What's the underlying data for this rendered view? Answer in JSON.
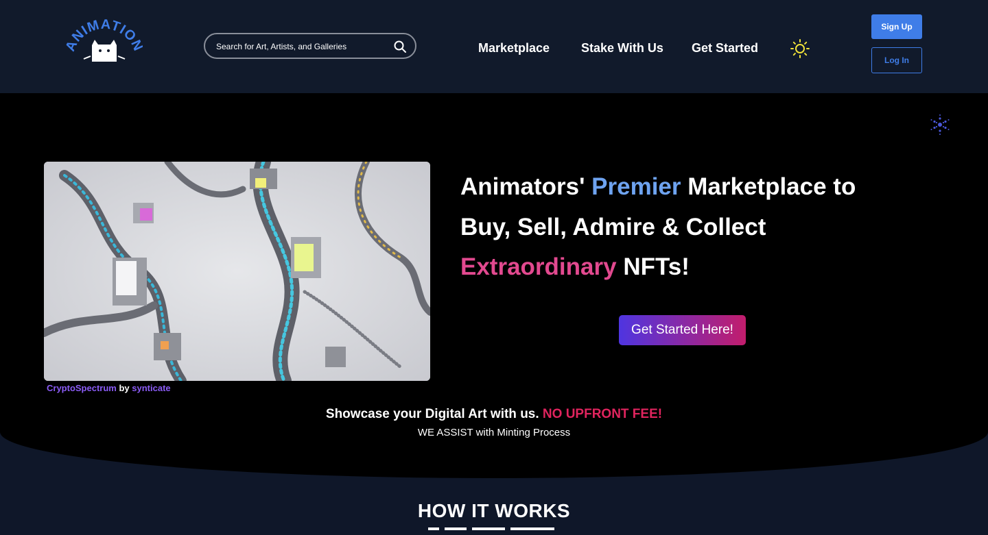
{
  "header": {
    "logo_text": "ANIMATION",
    "search": {
      "placeholder": "Search for Art, Artists, and Galleries",
      "icon": "search-icon"
    },
    "nav": [
      {
        "label": "Marketplace"
      },
      {
        "label": "Stake With Us"
      },
      {
        "label": "Get Started"
      }
    ],
    "theme_icon": "sun-icon",
    "sign_up_label": "Sign Up",
    "log_in_label": "Log In"
  },
  "hero": {
    "artwork": {
      "title": "CryptoSpectrum",
      "by": "by",
      "artist": "synticate"
    },
    "headline": {
      "part1": "Animators' ",
      "highlight1": "Premier",
      "part2": " Marketplace to Buy, Sell, Admire & Collect ",
      "highlight2": "Extraordinary",
      "part3": " NFTs!"
    },
    "cta_label": "Get Started Here!",
    "showcase_text": "Showcase your Digital Art with us. ",
    "showcase_highlight": "NO UPFRONT FEE!",
    "assist_text": "WE ASSIST with Minting Process"
  },
  "how_it_works": {
    "title": "HOW IT WORKS"
  },
  "colors": {
    "header_bg": "#111a2b",
    "page_bg": "#0f1729",
    "hero_bg": "#000000",
    "accent_blue": "#3f7de8",
    "premier_blue": "#6ea3f0",
    "extraordinary_pink": "#e2498f",
    "no_fee_red": "#e0245e",
    "caption_purple": "#8b5cf6",
    "sun_yellow": "#f2e33a"
  }
}
